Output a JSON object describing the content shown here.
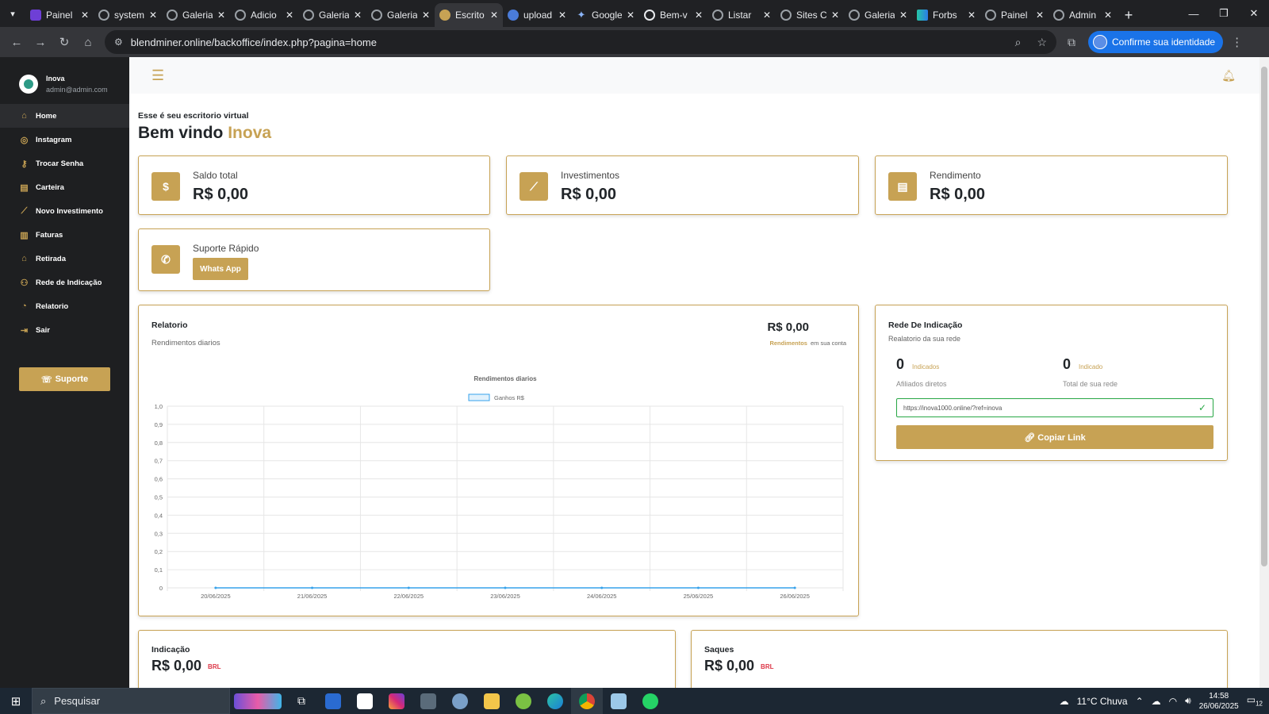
{
  "browser": {
    "tabs": [
      {
        "title": "Painel",
        "icon": "purple"
      },
      {
        "title": "system",
        "icon": "globe"
      },
      {
        "title": "Galeria",
        "icon": "globe"
      },
      {
        "title": "Adicio",
        "icon": "globe"
      },
      {
        "title": "Galeria",
        "icon": "globe"
      },
      {
        "title": "Galeria",
        "icon": "globe"
      },
      {
        "title": "Escrito",
        "icon": "gold",
        "active": true
      },
      {
        "title": "upload",
        "icon": "blue"
      },
      {
        "title": "Google",
        "icon": "star"
      },
      {
        "title": "Bem-v",
        "icon": "g"
      },
      {
        "title": "Listar",
        "icon": "globe"
      },
      {
        "title": "Sites C",
        "icon": "globe"
      },
      {
        "title": "Galeria",
        "icon": "globe"
      },
      {
        "title": "Forbs",
        "icon": "teal"
      },
      {
        "title": "Painel",
        "icon": "globe"
      },
      {
        "title": "Admin",
        "icon": "globe"
      }
    ],
    "url": "blendminer.online/backoffice/index.php?pagina=home",
    "identity_label": "Confirme sua identidade"
  },
  "sidebar": {
    "user_name": "Inova",
    "user_email": "admin@admin.com",
    "items": [
      {
        "label": "Home",
        "icon": "home-icon",
        "glyph": "⌂"
      },
      {
        "label": "Instagram",
        "icon": "instagram-icon",
        "glyph": "◎"
      },
      {
        "label": "Trocar Senha",
        "icon": "key-icon",
        "glyph": "⚷"
      },
      {
        "label": "Carteira",
        "icon": "wallet-icon",
        "glyph": "▤"
      },
      {
        "label": "Novo Investimento",
        "icon": "chart-line-icon",
        "glyph": "⟋"
      },
      {
        "label": "Faturas",
        "icon": "invoice-icon",
        "glyph": "▥"
      },
      {
        "label": "Retirada",
        "icon": "bank-icon",
        "glyph": "⌂"
      },
      {
        "label": "Rede de Indicação",
        "icon": "users-icon",
        "glyph": "⚇"
      },
      {
        "label": "Relatorio",
        "icon": "pie-chart-icon",
        "glyph": "◔"
      },
      {
        "label": "Sair",
        "icon": "logout-icon",
        "glyph": "⇥"
      }
    ],
    "support_label": "Suporte"
  },
  "welcome": {
    "subtitle": "Esse é seu escritorio virtual",
    "greeting": "Bem vindo",
    "name": "Inova"
  },
  "stats": [
    {
      "label": "Saldo total",
      "value": "R$ 0,00",
      "icon": "$"
    },
    {
      "label": "Investimentos",
      "value": "R$ 0,00",
      "icon": "⟋"
    },
    {
      "label": "Rendimento",
      "value": "R$ 0,00",
      "icon": "▤"
    }
  ],
  "support_card": {
    "label": "Suporte Rápido",
    "button": "Whats App"
  },
  "report": {
    "title": "Relatorio",
    "subtitle": "Rendimentos diarios",
    "value": "R$ 0,00",
    "note_highlight": "Rendimentos",
    "note_rest": "em sua conta"
  },
  "chart_data": {
    "type": "line",
    "title": "Rendimentos diarios",
    "categories": [
      "20/06/2025",
      "21/06/2025",
      "22/06/2025",
      "23/06/2025",
      "24/06/2025",
      "25/06/2025",
      "26/06/2025"
    ],
    "series": [
      {
        "name": "Ganhos R$",
        "values": [
          0,
          0,
          0,
          0,
          0,
          0,
          0
        ],
        "color": "#36a2eb"
      }
    ],
    "yticks": [
      "1,0",
      "0,9",
      "0,8",
      "0,7",
      "0,6",
      "0,5",
      "0,4",
      "0,3",
      "0,2",
      "0,1",
      "0"
    ],
    "ylim": [
      0,
      1
    ],
    "grid": true,
    "legend": "top"
  },
  "network": {
    "title": "Rede De Indicação",
    "subtitle": "Realatorio da sua rede",
    "direct_count": "0",
    "direct_tag": "Indicados",
    "direct_label": "Afiliados diretos",
    "total_count": "0",
    "total_tag": "Indicado",
    "total_label": "Total de sua rede",
    "link": "https://inova1000.online/?ref=inova",
    "copy_label": "Copiar Link"
  },
  "bottom": {
    "indicacao_title": "Indicação",
    "indicacao_value": "R$ 0,00",
    "saques_title": "Saques",
    "saques_value": "R$ 0,00",
    "currency": "BRL"
  },
  "taskbar": {
    "search": "Pesquisar",
    "weather": "11°C Chuva",
    "time": "14:58",
    "date": "26/06/2025",
    "notif": "12"
  },
  "colors": {
    "accent": "#c7a254",
    "sidebar": "#1e1f21",
    "success": "#28a745",
    "danger": "#dc3545"
  }
}
